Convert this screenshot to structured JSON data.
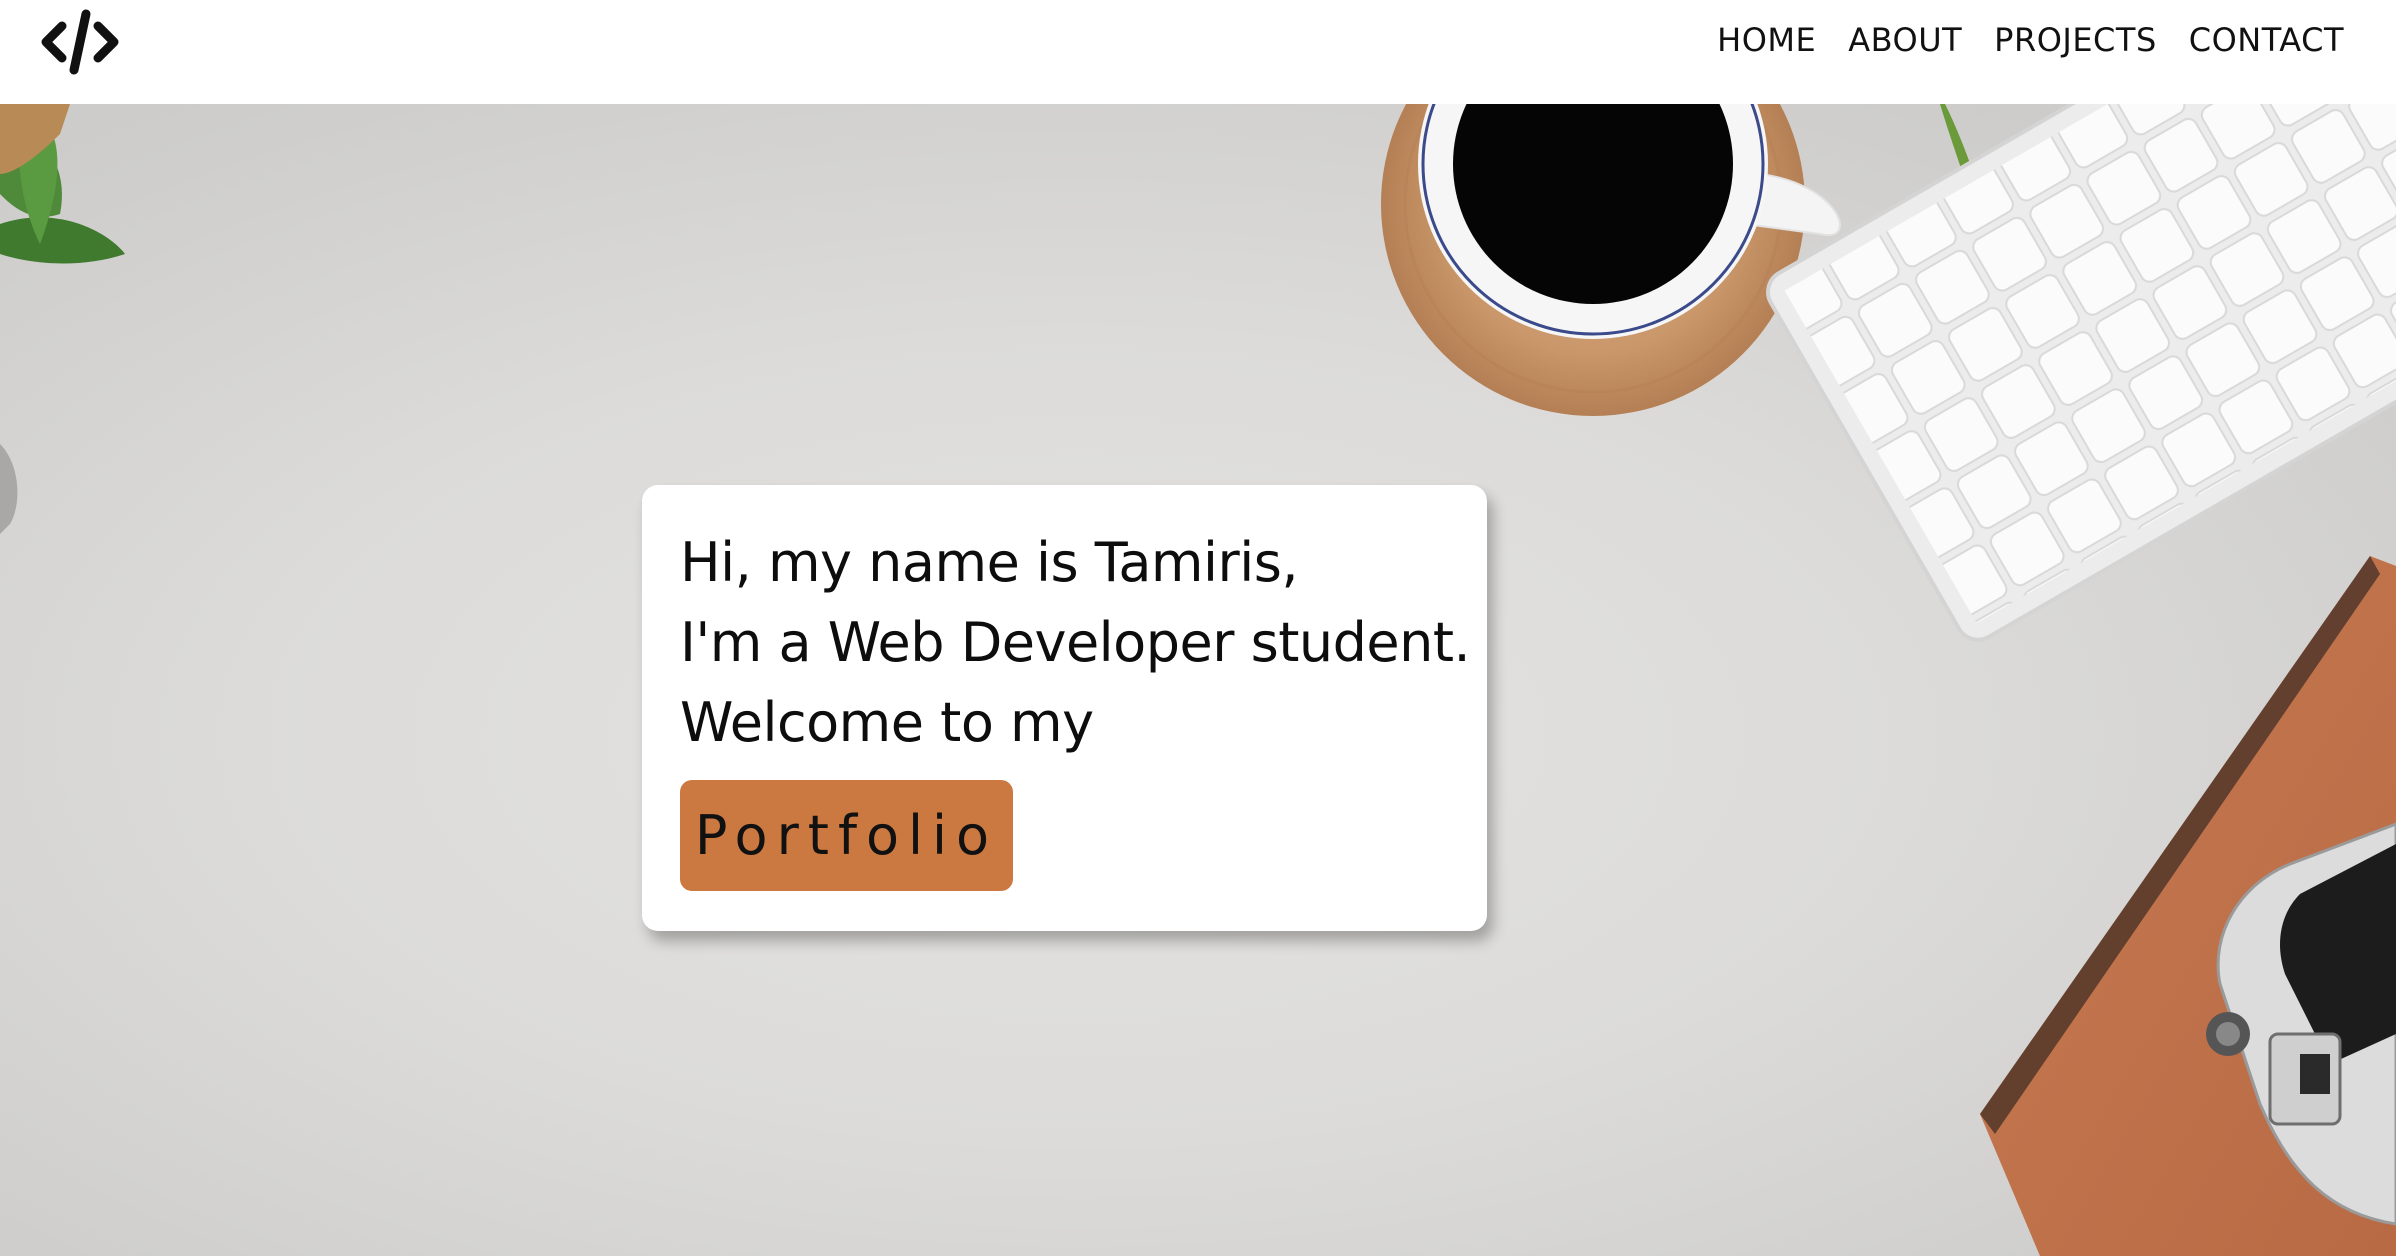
{
  "header": {
    "logo_icon": "code-slash-icon",
    "nav": [
      {
        "label": "HOME"
      },
      {
        "label": "ABOUT"
      },
      {
        "label": "PROJECTS"
      },
      {
        "label": "CONTACT"
      }
    ]
  },
  "hero": {
    "greeting_line1": "Hi, my name is Tamiris,",
    "greeting_line2": "I'm a Web Developer student.",
    "greeting_line3": "Welcome to my",
    "portfolio_button": "Portfolio"
  },
  "colors": {
    "accent": "#cb7841",
    "header_bg": "#ffffff",
    "desk_bg": "#dcdbd9",
    "text": "#111111"
  }
}
